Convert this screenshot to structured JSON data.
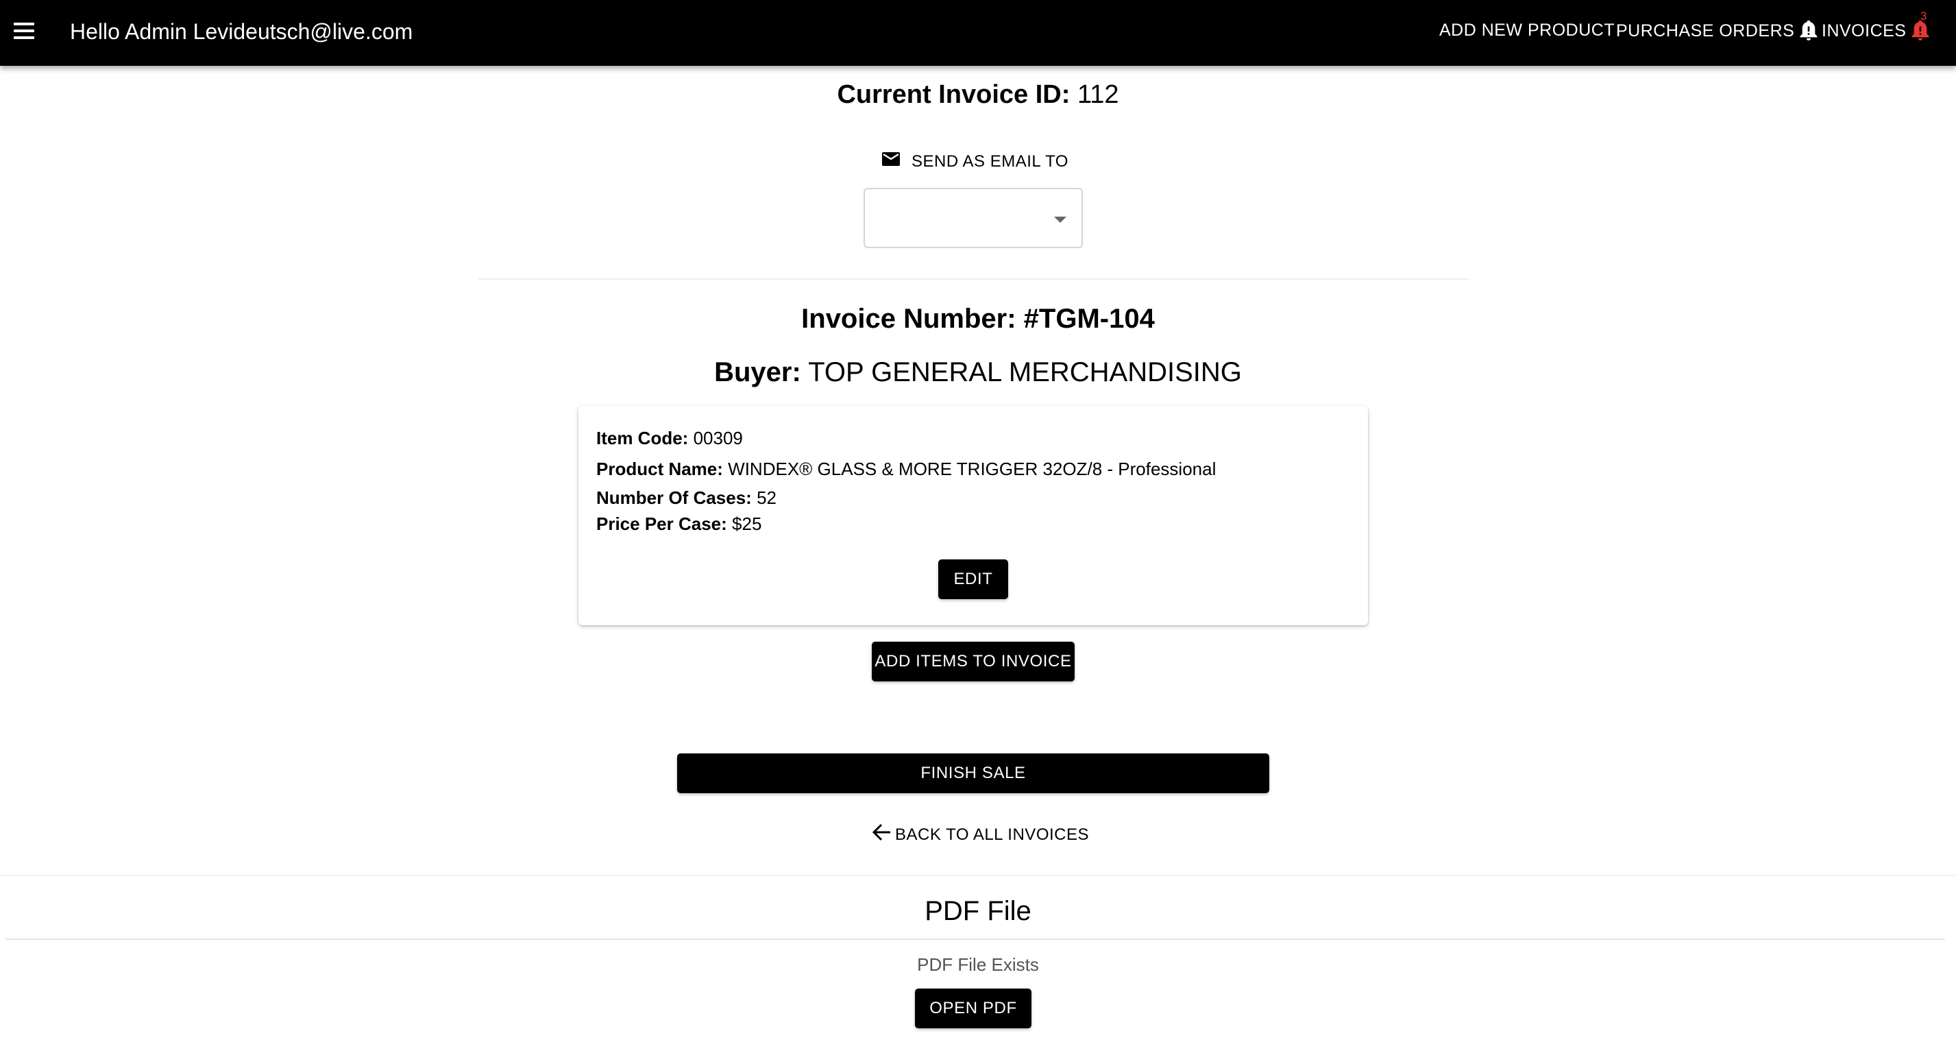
{
  "header": {
    "greeting": "Hello Admin Levideutsch@live.com",
    "nav": {
      "add_product": "ADD NEW PRODUCT",
      "purchase_orders": "PURCHASE ORDERS",
      "invoices": "INVOICES",
      "invoices_badge": "3"
    },
    "colors": {
      "background": "#000000",
      "badge": "#e53935"
    },
    "icons": [
      "menu-icon",
      "bell-icon",
      "bell-alert-icon"
    ]
  },
  "invoice": {
    "current_id_label": "Current Invoice ID:",
    "current_id_value": "112",
    "send_email_label": "SEND AS EMAIL TO",
    "email_select_value": "",
    "number_label": "Invoice Number:",
    "number_value": "#TGM-104",
    "buyer_label": "Buyer:",
    "buyer_value": "TOP GENERAL MERCHANDISING"
  },
  "item": {
    "code_label": "Item Code:",
    "code_value": "00309",
    "name_label": "Product Name:",
    "name_value": "WINDEX® GLASS & MORE TRIGGER 32OZ/8 - Professional",
    "cases_label": "Number Of Cases:",
    "cases_value": "52",
    "price_label": "Price Per Case:",
    "price_value": "$25",
    "edit_label": "EDIT"
  },
  "actions": {
    "add_items": "ADD ITEMS TO INVOICE",
    "finish_sale": "FINISH SALE",
    "back": "BACK TO ALL INVOICES"
  },
  "pdf": {
    "title": "PDF File",
    "status": "PDF File Exists",
    "open_label": "OPEN PDF"
  }
}
